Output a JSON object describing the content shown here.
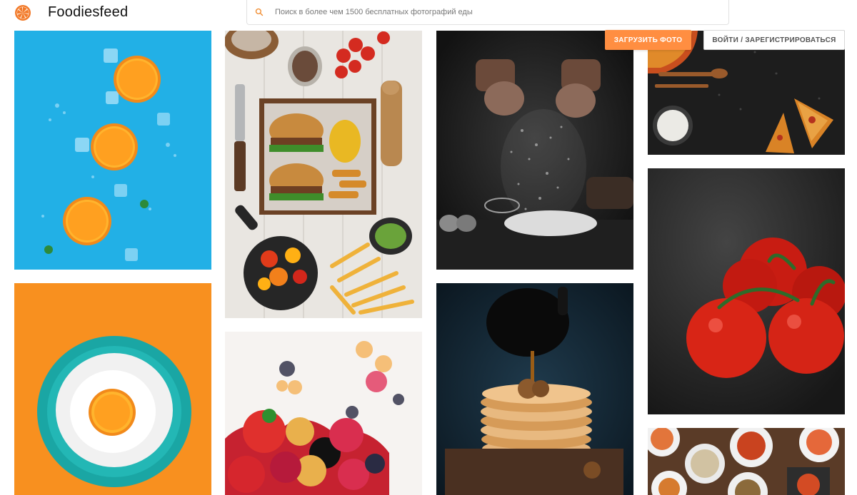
{
  "header": {
    "brand": "Foodiesfeed",
    "search_placeholder": "Поиск в более чем 1500 бесплатных фотографий еды",
    "upload_label": "ЗАГРУЗИТЬ ФОТО",
    "login_label": "ВОЙТИ / ЗАРЕГИСТРИРОВАТЬСЯ"
  },
  "colors": {
    "accent": "#ff8e41",
    "logo": "#f27a2a"
  },
  "icons": {
    "logo": "orange-slice-icon",
    "search": "search-icon"
  },
  "photos": [
    {
      "name": "oranges-on-blue"
    },
    {
      "name": "burgers-and-fries"
    },
    {
      "name": "flour-hands"
    },
    {
      "name": "pizza-slices"
    },
    {
      "name": "orange-on-plate"
    },
    {
      "name": "berries"
    },
    {
      "name": "pancakes-syrup"
    },
    {
      "name": "tomatoes"
    },
    {
      "name": "asian-dishes"
    }
  ]
}
